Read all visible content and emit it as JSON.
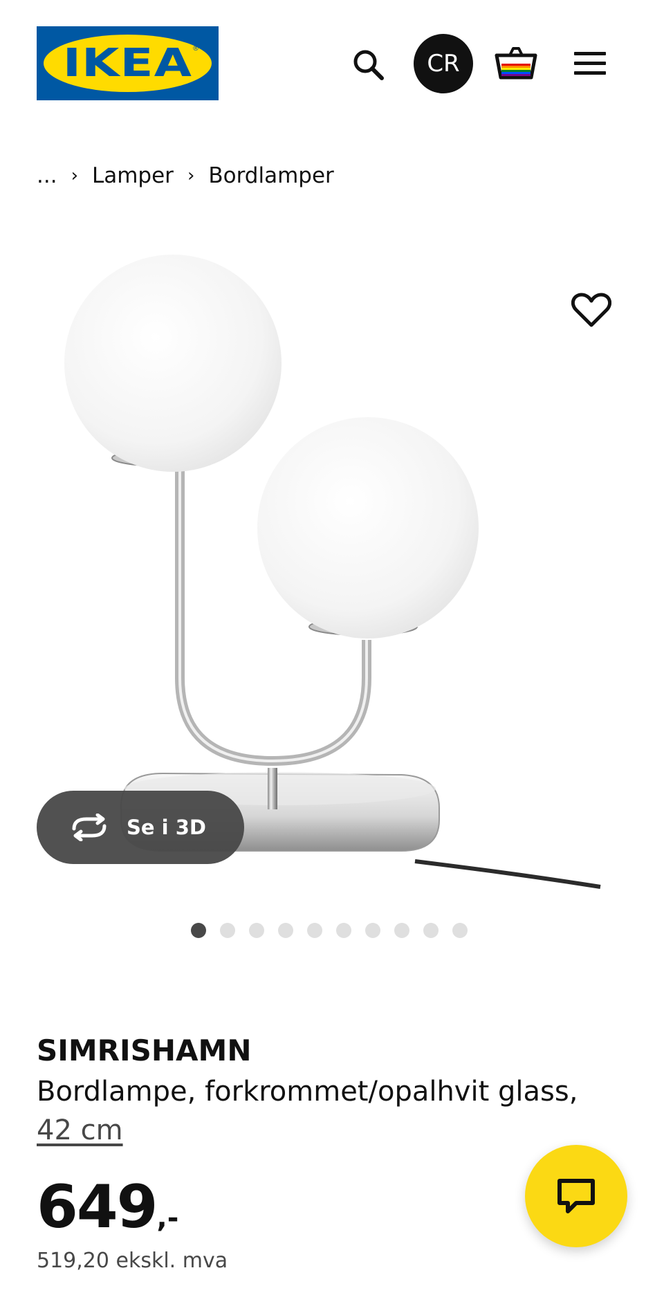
{
  "header": {
    "logo_text": "IKEA",
    "logo_trademark": "®",
    "avatar_initials": "CR",
    "icons": [
      "search-icon",
      "basket-icon",
      "menu-icon"
    ]
  },
  "breadcrumb": {
    "items": [
      "...",
      "Lamper",
      "Bordlamper"
    ]
  },
  "gallery": {
    "view_3d_label": "Se i 3D",
    "image_count": 10,
    "active_index": 0,
    "favorite_icon": "heart-icon"
  },
  "product": {
    "name": "SIMRISHAMN",
    "description": "Bordlampe, forkrommet/opalhvit glass,",
    "measure": "42 cm",
    "price_main": "649",
    "price_suffix": ",-",
    "price_ex_vat": "519,20 ekskl. mva"
  },
  "chat": {
    "icon": "chat-icon"
  },
  "colors": {
    "brand_blue": "#0058a3",
    "brand_yellow": "#ffdb00",
    "chat_yellow": "#fbd914"
  }
}
